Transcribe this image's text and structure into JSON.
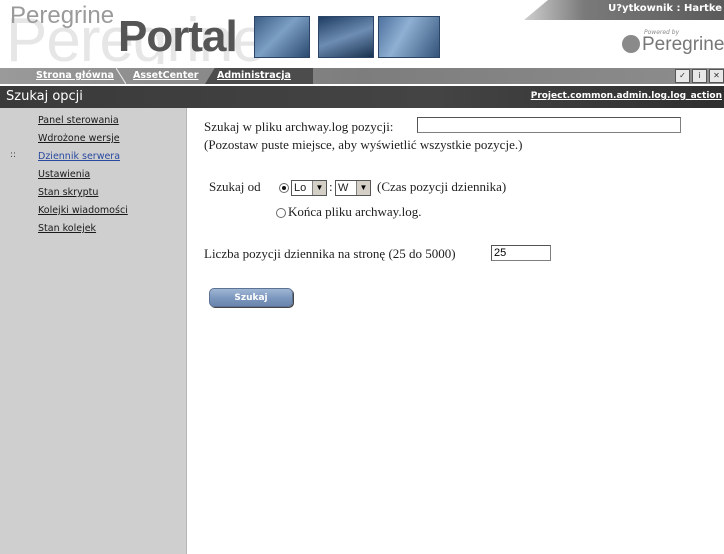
{
  "header": {
    "logo_small": "Peregrine",
    "logo_big": "Portal",
    "logo_watermark": "Peregrine",
    "user_label": "U?ytkownik : Hartke",
    "powered_by_small": "Powered by",
    "powered_by_name": "Peregrine"
  },
  "nav": {
    "tabs": [
      {
        "label": "Strona główna"
      },
      {
        "label": "AssetCenter"
      },
      {
        "label": "Administracja"
      }
    ],
    "icons": [
      "check-icon",
      "info-icon",
      "close-icon"
    ]
  },
  "title_bar": {
    "title": "Szukaj opcji",
    "path": "Project.common.admin.log.log_action"
  },
  "sidebar": {
    "items": [
      {
        "label": "Panel sterowania"
      },
      {
        "label": "Wdrożone wersje"
      },
      {
        "label": "Dziennik serwera",
        "marker": "::"
      },
      {
        "label": "Ustawienia"
      },
      {
        "label": "Stan skryptu"
      },
      {
        "label": "Kolejki wiadomości"
      },
      {
        "label": "Stan kolejek"
      }
    ]
  },
  "form": {
    "search_label": "Szukaj w pliku archway.log pozycji:",
    "search_value": "",
    "search_hint": "(Pozostaw puste miejsce, aby wyświetlić wszystkie pozycje.)",
    "search_from_label": "Szukaj od",
    "option_time_value1": "Lo",
    "option_time_sep": ":",
    "option_time_value2": "W",
    "option_time_note": "(Czas pozycji dziennika)",
    "option_end_label": "Końca pliku archway.log.",
    "per_page_label": "Liczba pozycji dziennika na stronę (25 do 5000)",
    "per_page_value": "25",
    "submit_label": "Szukaj"
  },
  "colors": {
    "sidebar_bg": "#cfcfcf",
    "titlebar_bg": "#3a3a3a",
    "nav_strip": "#8a8a8a",
    "active_link": "#2a4aa0",
    "button": "#7b96bd"
  }
}
